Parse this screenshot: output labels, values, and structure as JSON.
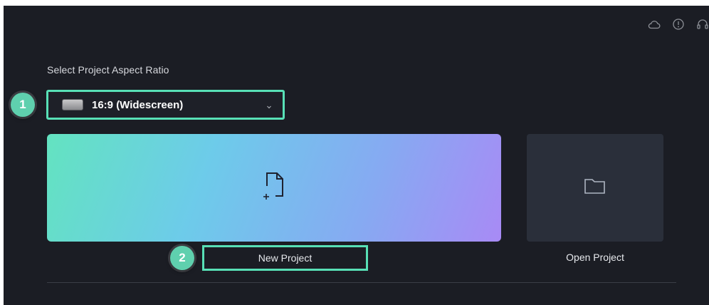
{
  "header": {
    "icons": [
      "cloud-icon",
      "info-icon",
      "headset-icon"
    ]
  },
  "aspect_ratio": {
    "section_title": "Select Project Aspect Ratio",
    "selected_value": "16:9 (Widescreen)"
  },
  "steps": {
    "step1": "1",
    "step2": "2"
  },
  "actions": {
    "new_project_label": "New Project",
    "open_project_label": "Open Project"
  },
  "colors": {
    "background": "#1b1d24",
    "highlight": "#58e0b6",
    "badge": "#5fd0ae",
    "open_card": "#2a2f3a"
  }
}
